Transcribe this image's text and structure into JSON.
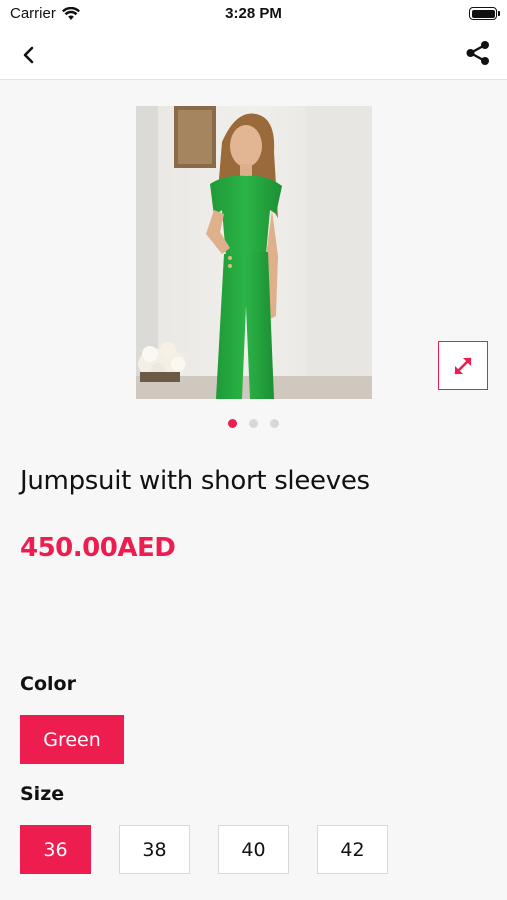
{
  "status_bar": {
    "carrier": "Carrier",
    "time": "3:28 PM"
  },
  "nav": {
    "back_icon": "chevron-left-icon",
    "share_icon": "share-icon"
  },
  "gallery": {
    "image_description_icon": "product-photo",
    "expand_icon": "expand-arrows-icon",
    "page_count": 3,
    "current_page": 1
  },
  "product": {
    "title": "Jumpsuit with short sleeves",
    "price": "450.00AED"
  },
  "color": {
    "label": "Color",
    "options": [
      "Green"
    ],
    "selected": "Green"
  },
  "size": {
    "label": "Size",
    "options": [
      "36",
      "38",
      "40",
      "42"
    ],
    "selected": "36"
  },
  "colors": {
    "accent": "#ee1d4f",
    "background": "#f7f7f8",
    "garment": "#22a63c"
  }
}
